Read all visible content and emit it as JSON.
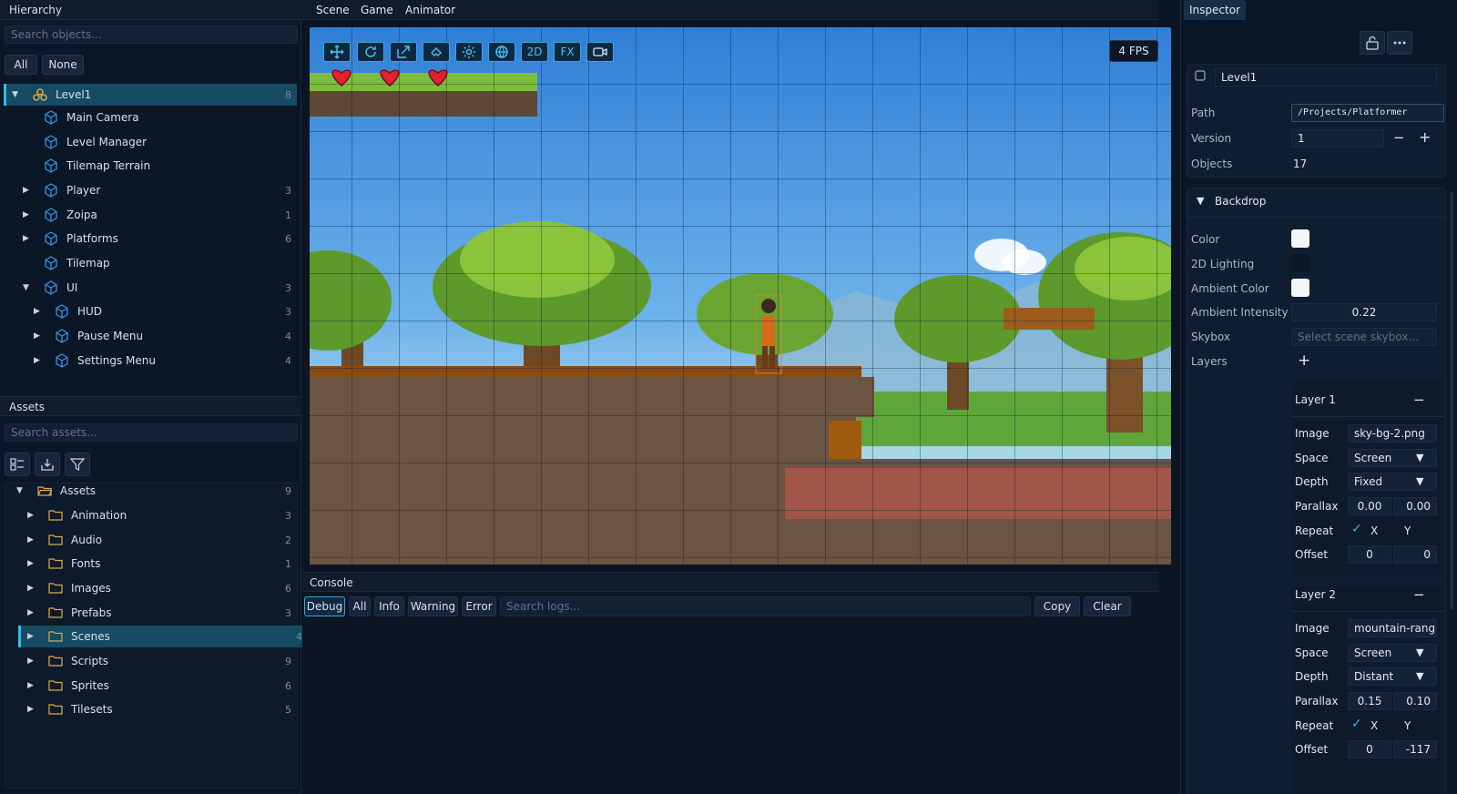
{
  "hierarchy": {
    "title": "Hierarchy",
    "search_placeholder": "Search objects...",
    "btn_all": "All",
    "btn_none": "None",
    "items": [
      {
        "label": "Level1",
        "count": "8"
      },
      {
        "label": "Main Camera",
        "count": ""
      },
      {
        "label": "Level Manager",
        "count": ""
      },
      {
        "label": "Tilemap Terrain",
        "count": ""
      },
      {
        "label": "Player",
        "count": "3"
      },
      {
        "label": "Zoipa",
        "count": "1"
      },
      {
        "label": "Platforms",
        "count": "6"
      },
      {
        "label": "Tilemap",
        "count": ""
      },
      {
        "label": "UI",
        "count": "3"
      },
      {
        "label": "HUD",
        "count": "3"
      },
      {
        "label": "Pause Menu",
        "count": "4"
      },
      {
        "label": "Settings Menu",
        "count": "4"
      }
    ]
  },
  "assets": {
    "title": "Assets",
    "search_placeholder": "Search assets...",
    "items": [
      {
        "label": "Assets",
        "count": "9"
      },
      {
        "label": "Animation",
        "count": "3"
      },
      {
        "label": "Audio",
        "count": "2"
      },
      {
        "label": "Fonts",
        "count": "1"
      },
      {
        "label": "Images",
        "count": "6"
      },
      {
        "label": "Prefabs",
        "count": "3"
      },
      {
        "label": "Scenes",
        "count": "4"
      },
      {
        "label": "Scripts",
        "count": "9"
      },
      {
        "label": "Sprites",
        "count": "6"
      },
      {
        "label": "Tilesets",
        "count": "5"
      }
    ]
  },
  "menu": {
    "scene": "Scene",
    "game": "Game",
    "animator": "Animator"
  },
  "viewport": {
    "tools": {
      "mode_2d": "2D",
      "fx": "FX"
    },
    "fps": "4 FPS"
  },
  "console": {
    "title": "Console",
    "filters": {
      "debug": "Debug",
      "all": "All",
      "info": "Info",
      "warning": "Warning",
      "error": "Error"
    },
    "search_placeholder": "Search logs...",
    "copy": "Copy",
    "clear": "Clear"
  },
  "inspector": {
    "tab": "Inspector",
    "object_name": "Level1",
    "path_label": "Path",
    "path_value": "/Projects/Platformer",
    "version_label": "Version",
    "version_value": "1",
    "version_minus": "−",
    "version_plus": "+",
    "objects_label": "Objects",
    "objects_value": "17",
    "backdrop": {
      "title": "Backdrop",
      "color_label": "Color",
      "lighting_label": "2D Lighting",
      "ambient_color_label": "Ambient Color",
      "ambient_intensity_label": "Ambient Intensity",
      "ambient_intensity_value": "0.22",
      "skybox_label": "Skybox",
      "skybox_placeholder": "Select scene skybox...",
      "layers_label": "Layers",
      "add_layer": "+",
      "layers": [
        {
          "title": "Layer 1",
          "remove": "−",
          "image_label": "Image",
          "image": "sky-bg-2.png",
          "space_label": "Space",
          "space": "Screen",
          "depth_label": "Depth",
          "depth": "Fixed",
          "parallax_label": "Parallax",
          "parallax_x": "0.00",
          "parallax_y": "0.00",
          "repeat_label": "Repeat",
          "repeat_x_label": "X",
          "repeat_y_label": "Y",
          "offset_label": "Offset",
          "offset_x": "0",
          "offset_y": "0"
        },
        {
          "title": "Layer 2",
          "remove": "−",
          "image_label": "Image",
          "image": "mountain-rang",
          "space_label": "Space",
          "space": "Screen",
          "depth_label": "Depth",
          "depth": "Distant",
          "parallax_label": "Parallax",
          "parallax_x": "0.15",
          "parallax_y": "0.10",
          "repeat_label": "Repeat",
          "repeat_x_label": "X",
          "repeat_y_label": "Y",
          "offset_label": "Offset",
          "offset_x": "0",
          "offset_y": "-117"
        }
      ]
    }
  },
  "colors": {
    "accent": "#2ec2e8",
    "selection": "#154b63",
    "panel": "#0b1626",
    "folder": "#e0a84a",
    "cube": "#3b8fe0"
  }
}
